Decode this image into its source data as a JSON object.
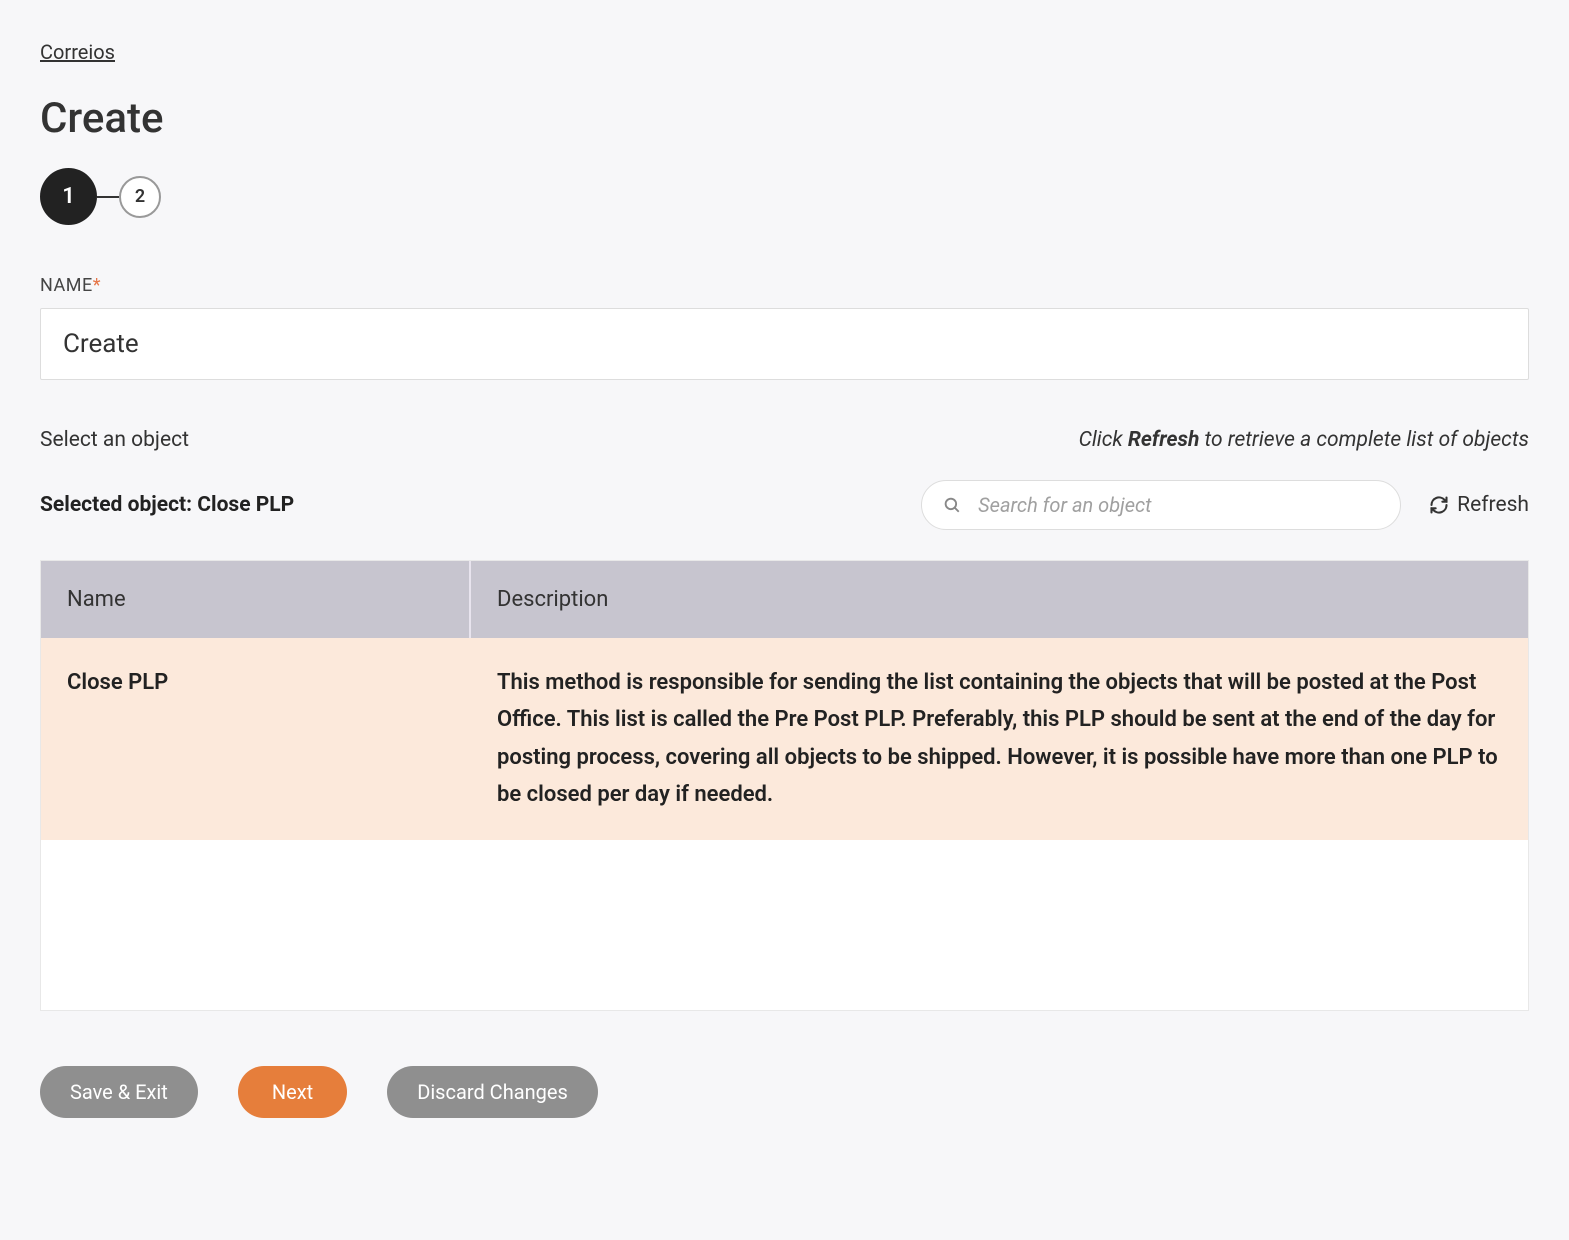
{
  "breadcrumb": "Correios",
  "page_title": "Create",
  "steps": {
    "active": "1",
    "next": "2"
  },
  "name_field": {
    "label": "NAME",
    "value": "Create"
  },
  "select_section": {
    "label": "Select an object",
    "hint_prefix": "Click ",
    "hint_bold": "Refresh",
    "hint_suffix": " to retrieve a complete list of objects",
    "selected_prefix": "Selected object: ",
    "selected_name": "Close PLP",
    "search_placeholder": "Search for an object",
    "refresh_label": "Refresh"
  },
  "table": {
    "headers": {
      "name": "Name",
      "description": "Description"
    },
    "rows": [
      {
        "name": "Close PLP",
        "description": "This method is responsible for sending the list containing the objects that will be posted at the Post Office. This list is called the Pre Post PLP. Preferably, this PLP should be sent at the end of the day for posting process, covering all objects to be shipped. However, it is possible have more than one PLP to be closed per day if needed."
      }
    ]
  },
  "buttons": {
    "save_exit": "Save & Exit",
    "next": "Next",
    "discard": "Discard Changes"
  }
}
